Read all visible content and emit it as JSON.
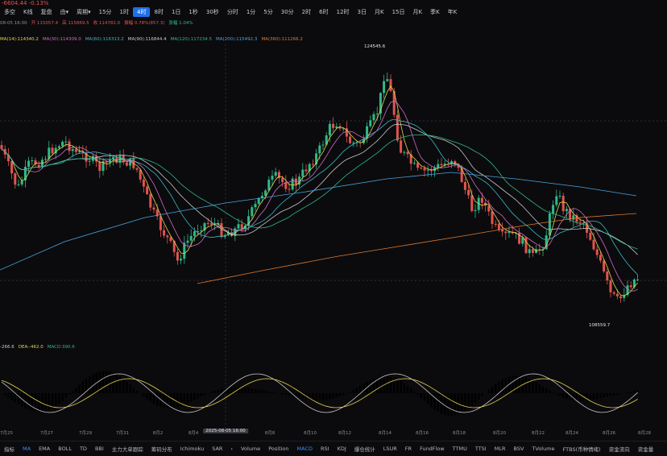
{
  "header": {
    "change_text": "-6604.44 -0.13%"
  },
  "toolbar": {
    "items": [
      "多空",
      "K线",
      "复盘",
      "由▾",
      "周期▾",
      "15分",
      "1时",
      "4时",
      "8时",
      "1日",
      "1秒",
      "30秒",
      "分时",
      "1分",
      "5分",
      "30分",
      "2时",
      "6时",
      "12时",
      "3日",
      "月K",
      "15日",
      "月K",
      "季K",
      "年K"
    ],
    "active_index": 7,
    "tool_icons": [
      {
        "label": "多",
        "color": "#e3b341"
      },
      {
        "label": "主",
        "color": "#e3b341"
      },
      {
        "label": "大",
        "color": "#e3b341"
      },
      {
        "label": "筹",
        "color": "#e3b341"
      }
    ]
  },
  "ohlc_info": [
    "08-05 16:00",
    "开 115057.4",
    "高 115869.5",
    "收 114782.0",
    "振幅 0.78%(857.3)",
    "涨幅 1.04%"
  ],
  "ma_info": [
    {
      "text": "MA(14):114340.2",
      "color": "#e8d44d"
    },
    {
      "text": "MA(30):114309.0",
      "color": "#d36ac2"
    },
    {
      "text": "MA(60):116313.2",
      "color": "#3fb5c7"
    },
    {
      "text": "MA(90):116844.4",
      "color": "#c8c8c8"
    },
    {
      "text": "MA(120):117234.5",
      "color": "#2fb98a"
    },
    {
      "text": "MA(200):115492.3",
      "color": "#4aa3e0"
    },
    {
      "text": "MA(360):111266.2",
      "color": "#e07a2f"
    }
  ],
  "price_annotations": {
    "high": "124545.6",
    "low": "108559.7"
  },
  "macd_info": [
    {
      "text": "-266.6",
      "color": "#c8c8c8"
    },
    {
      "text": "DEA:-462.0",
      "color": "#e8d44d"
    },
    {
      "text": "MACD:390.6",
      "color": "#2fb98a"
    }
  ],
  "x_axis": {
    "labels": [
      "7月25",
      "7月27",
      "7月29",
      "7月31",
      "8月2",
      "8月4",
      "8月8",
      "8月10",
      "8月12",
      "8月14",
      "8月16",
      "8月18",
      "8月20",
      "8月22",
      "8月24",
      "8月26",
      "8月28"
    ],
    "crosshair": "2025-08-05 16:00"
  },
  "indicator_bar": [
    "指标",
    "MA",
    "EMA",
    "BOLL",
    "TD",
    "BBI",
    "主力大单跟踪",
    "筹码分布",
    "Ichimoku",
    "SAR",
    "›",
    "Volume",
    "Position",
    "MACD",
    "RSI",
    "KDJ",
    "爆仓统计",
    "LSUR",
    "FR",
    "FundFlow",
    "TTMU",
    "TTSI",
    "MLR",
    "BSV",
    "TVolume",
    "FTBS(币种情绪)",
    "资金流向",
    "资金量"
  ],
  "indicator_active": [
    "MA",
    "MACD"
  ],
  "colors": {
    "up": "#2fb98a",
    "down": "#e0544f",
    "background": "#0b0b0d",
    "accent": "#1f6feb"
  }
}
